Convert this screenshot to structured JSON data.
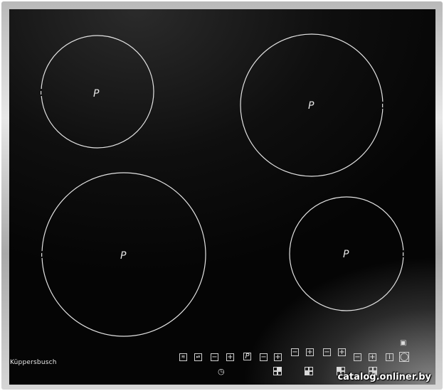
{
  "brand": "Küppersbusch",
  "watermark": "catalog.onliner.by",
  "zones": [
    {
      "id": "rear-left",
      "label": "P"
    },
    {
      "id": "rear-right",
      "label": "P"
    },
    {
      "id": "front-left",
      "label": "P"
    },
    {
      "id": "front-right",
      "label": "P"
    }
  ],
  "controls": {
    "minus": "−",
    "plus": "+",
    "p_key": "P",
    "info": "i",
    "lock_indicator": "▣",
    "power_symbol": "◯",
    "timer_symbol": "◷",
    "wave_key": "≋",
    "pause_key": "⏯"
  }
}
